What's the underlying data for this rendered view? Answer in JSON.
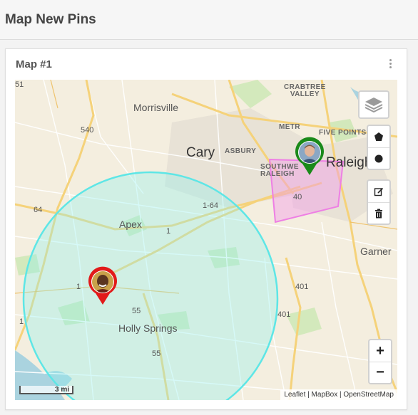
{
  "header": {
    "title": "Map New Pins"
  },
  "card": {
    "title": "Map #1"
  },
  "map": {
    "labels": {
      "crabtree_valley": "CRABTREE\nVALLEY",
      "morrisville": "Morrisville",
      "metro": "METR",
      "five_points": "FIVE POINTS",
      "cary": "Cary",
      "asbury": "ASBURY",
      "raleigh": "Raleigh",
      "southwest_raleigh": "SOUTHWE\nRALEIGH",
      "route_540": "540",
      "route_64": "64",
      "route_1_64": "1-64",
      "route_40": "40",
      "apex": "Apex",
      "route_1_a": "1",
      "route_1_b": "1",
      "route_1_c": "1",
      "garner": "Garner",
      "route_401_a": "401",
      "route_401_b": "401",
      "route_55_a": "55",
      "route_55_b": "55",
      "holly_springs": "Holly Springs",
      "edge_51": "51"
    },
    "scale": "3 mi",
    "attribution": {
      "leaflet": "Leaflet",
      "sep1": " | ",
      "mapbox": "MapBox",
      "sep2": " | ",
      "osm": "OpenStreetMap"
    },
    "colors": {
      "circle": "#5ee6e6",
      "polygon": "#f29be9",
      "pin_green": "#1a8a1a",
      "pin_red": "#e21a1a"
    },
    "controls": {
      "layers": "layers-icon",
      "draw_polygon": "pentagon-icon",
      "draw_circle": "circle-icon",
      "edit": "edit-icon",
      "delete": "trash-icon",
      "zoom_in": "+",
      "zoom_out": "−"
    }
  }
}
